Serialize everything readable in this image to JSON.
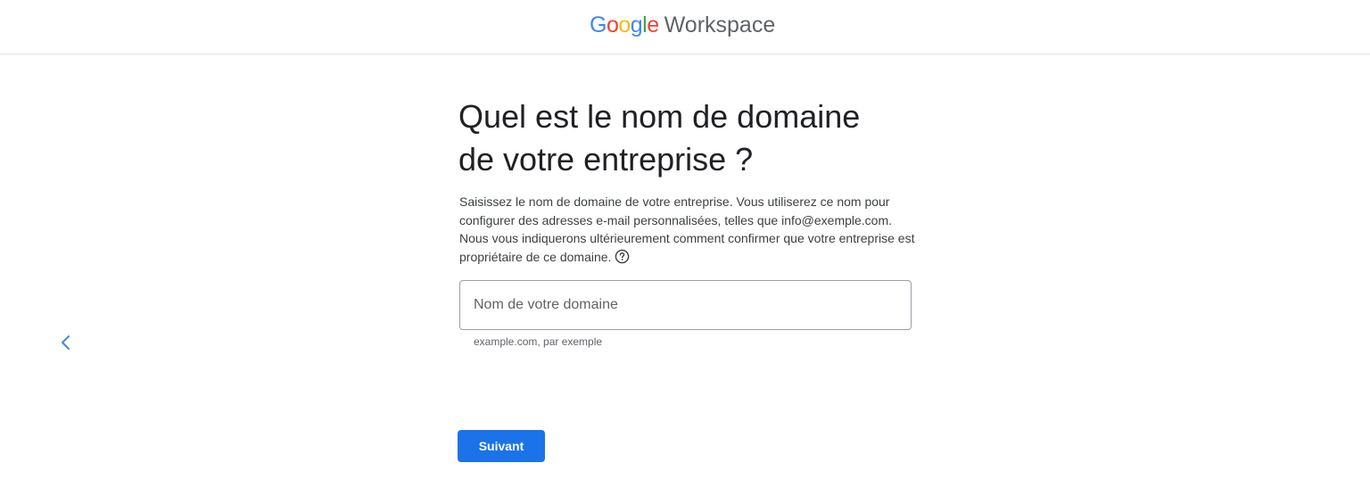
{
  "header": {
    "logo": {
      "letters": [
        {
          "char": "G",
          "color": "#4285F4"
        },
        {
          "char": "o",
          "color": "#EA4335"
        },
        {
          "char": "o",
          "color": "#FBBC05"
        },
        {
          "char": "g",
          "color": "#4285F4"
        },
        {
          "char": "l",
          "color": "#34A853"
        },
        {
          "char": "e",
          "color": "#EA4335"
        }
      ],
      "product": "Workspace"
    }
  },
  "nav": {
    "back_icon": "chevron-left-icon",
    "back_icon_color": "#4285F4"
  },
  "main": {
    "title_line1": "Quel est le nom de domaine",
    "title_line2": "de votre entreprise ?",
    "description": "Saisissez le nom de domaine de votre entreprise. Vous utiliserez ce nom pour configurer des adresses e-mail personnalisées, telles que info@exemple.com. Nous vous indiquerons ultérieurement comment confirmer que votre entreprise est propriétaire de ce domaine.",
    "help_icon": "help-circle-icon",
    "domain_input": {
      "placeholder": "Nom de votre domaine",
      "value": ""
    },
    "hint": "example.com, par exemple",
    "next_button_label": "Suivant"
  },
  "colors": {
    "accent": "#1a73e8",
    "text_primary": "#202124",
    "text_secondary": "#5f6368"
  }
}
